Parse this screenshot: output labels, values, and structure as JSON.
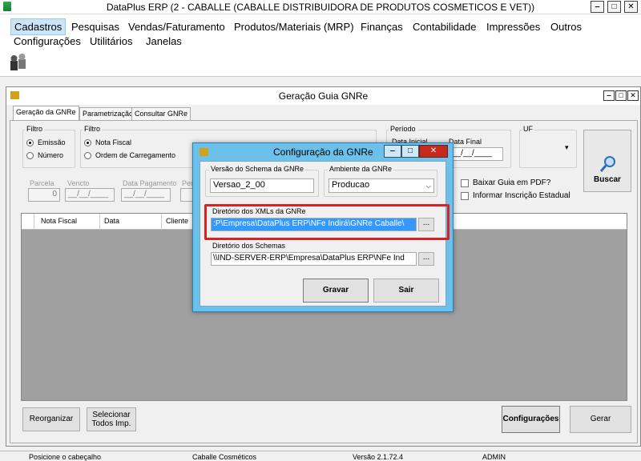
{
  "window": {
    "title": "DataPlus ERP (2 - CABALLE  (CABALLE DISTRIBUIDORA DE PRODUTOS COSMETICOS E VET))",
    "minimize": "‒",
    "maximize": "□",
    "close": "✕"
  },
  "menu": {
    "row1": [
      "Cadastros",
      "Pesquisas",
      "Vendas/Faturamento",
      "Produtos/Materiais (MRP)",
      "Finanças",
      "Contabilidade",
      "Impressões",
      "Outros"
    ],
    "row2": [
      "Configurações",
      "Utilitários",
      "Janelas"
    ]
  },
  "child": {
    "title": "Geração Guia GNRe",
    "tabs": [
      "Geração da GNRe",
      "Parametrização",
      "Consultar GNRe"
    ],
    "filtro1": {
      "label": "Filtro",
      "options": [
        "Emissão",
        "Número"
      ]
    },
    "filtro2": {
      "label": "Filtro",
      "options": [
        "Nota Fiscal",
        "Ordem de Carregamento"
      ]
    },
    "periodo": {
      "label": "Período",
      "inicial": "Data Inicial",
      "final": "Data Final",
      "final_value": "__/__/____"
    },
    "uf": {
      "label": "UF",
      "arrow": "▾"
    },
    "buscar": "Buscar",
    "row2": {
      "parcela": "Parcela",
      "parcela_value": "0",
      "vencto": "Vencto",
      "vencto_value": "__/__/____",
      "data_pagamento": "Data Pagamento",
      "data_pagamento_value": "__/__/____",
      "per": "Per"
    },
    "checks": [
      "Baixar Guia em PDF?",
      "Informar Inscrição Estadual"
    ],
    "grid_columns": [
      "Nota Fiscal",
      "Data",
      "Cliente"
    ],
    "buttons": {
      "reorganizar": "Reorganizar",
      "selecionar1": "Selecionar",
      "selecionar2": "Todos Imp.",
      "configuracoes": "Configurações",
      "gerar": "Gerar"
    }
  },
  "dialog": {
    "title": "Configuração da GNRe",
    "minimize": "‒",
    "maximize": "□",
    "close": "✕",
    "schema_version_label": "Versão do Schema da GNRe",
    "schema_version_value": "Versao_2_00",
    "ambiente_label": "Ambiente da GNRe",
    "ambiente_value": "Producao",
    "xml_dir_label": "Diretório dos XMLs da GNRe",
    "xml_dir_value": ":P\\Empresa\\DataPlus ERP\\NFe Indirá\\GNRe Caballe\\",
    "schemas_dir_label": "Diretório dos Schemas",
    "schemas_dir_value": "\\\\IND-SERVER-ERP\\Empresa\\DataPlus ERP\\NFe Ind",
    "browse": "...",
    "gravar": "Gravar",
    "sair": "Sair"
  },
  "status": {
    "items": [
      "Posicione o cabeçalho",
      "Caballe Cosméticos",
      "Versão 2.1.72.4",
      "ADMIN"
    ]
  },
  "colors": {
    "dialog_frame": "#6cc1ea",
    "highlight": "#e02020",
    "selection": "#3399ff"
  }
}
